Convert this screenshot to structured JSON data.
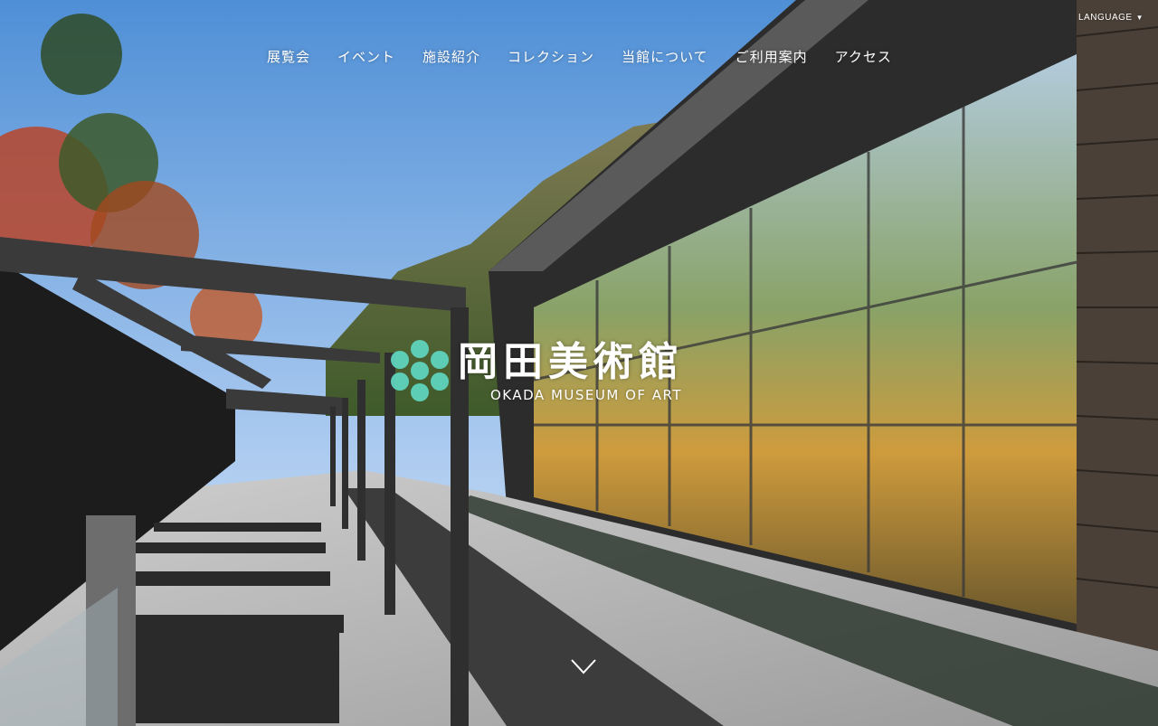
{
  "header": {
    "language_label": "LANGUAGE",
    "language_caret": "▼"
  },
  "nav": {
    "items": [
      {
        "label": "展覧会"
      },
      {
        "label": "イベント"
      },
      {
        "label": "施設紹介"
      },
      {
        "label": "コレクション"
      },
      {
        "label": "当館について"
      },
      {
        "label": "ご利用案内"
      },
      {
        "label": "アクセス"
      }
    ]
  },
  "logo": {
    "jp": "岡田美術館",
    "en": "OKADA MUSEUM OF ART",
    "mark_color": "#5fd3bd"
  },
  "hero": {
    "scroll_icon": "chevron-down-icon"
  }
}
